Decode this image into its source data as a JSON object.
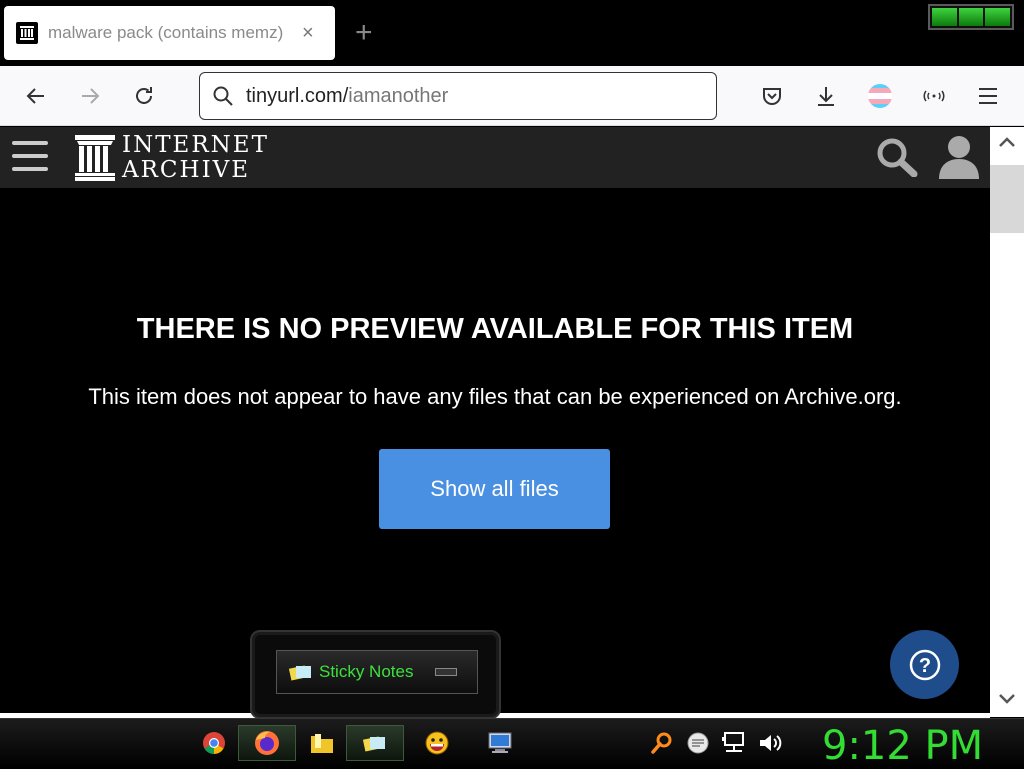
{
  "browser": {
    "tab": {
      "title": "malware pack (contains memz)",
      "close": "×"
    },
    "new_tab": "+",
    "url": {
      "host": "tinyurl.com/",
      "path": "iamanother"
    }
  },
  "site": {
    "logo_line1": "INTERNET",
    "logo_line2": "ARCHIVE"
  },
  "content": {
    "title": "THERE IS NO PREVIEW AVAILABLE FOR THIS ITEM",
    "description": "This item does not appear to have any files that can be experienced on Archive.org.",
    "button": "Show all files",
    "help": "?"
  },
  "popup": {
    "label": "Sticky Notes"
  },
  "taskbar": {
    "clock": "9:12 PM",
    "items": [
      "chrome-icon",
      "firefox-icon",
      "folder-icon",
      "sticky-notes-icon",
      "messenger-icon",
      "computer-icon"
    ]
  },
  "colors": {
    "accent": "#4a90e2",
    "clock": "#33dd33",
    "help": "#1f4d8c"
  }
}
